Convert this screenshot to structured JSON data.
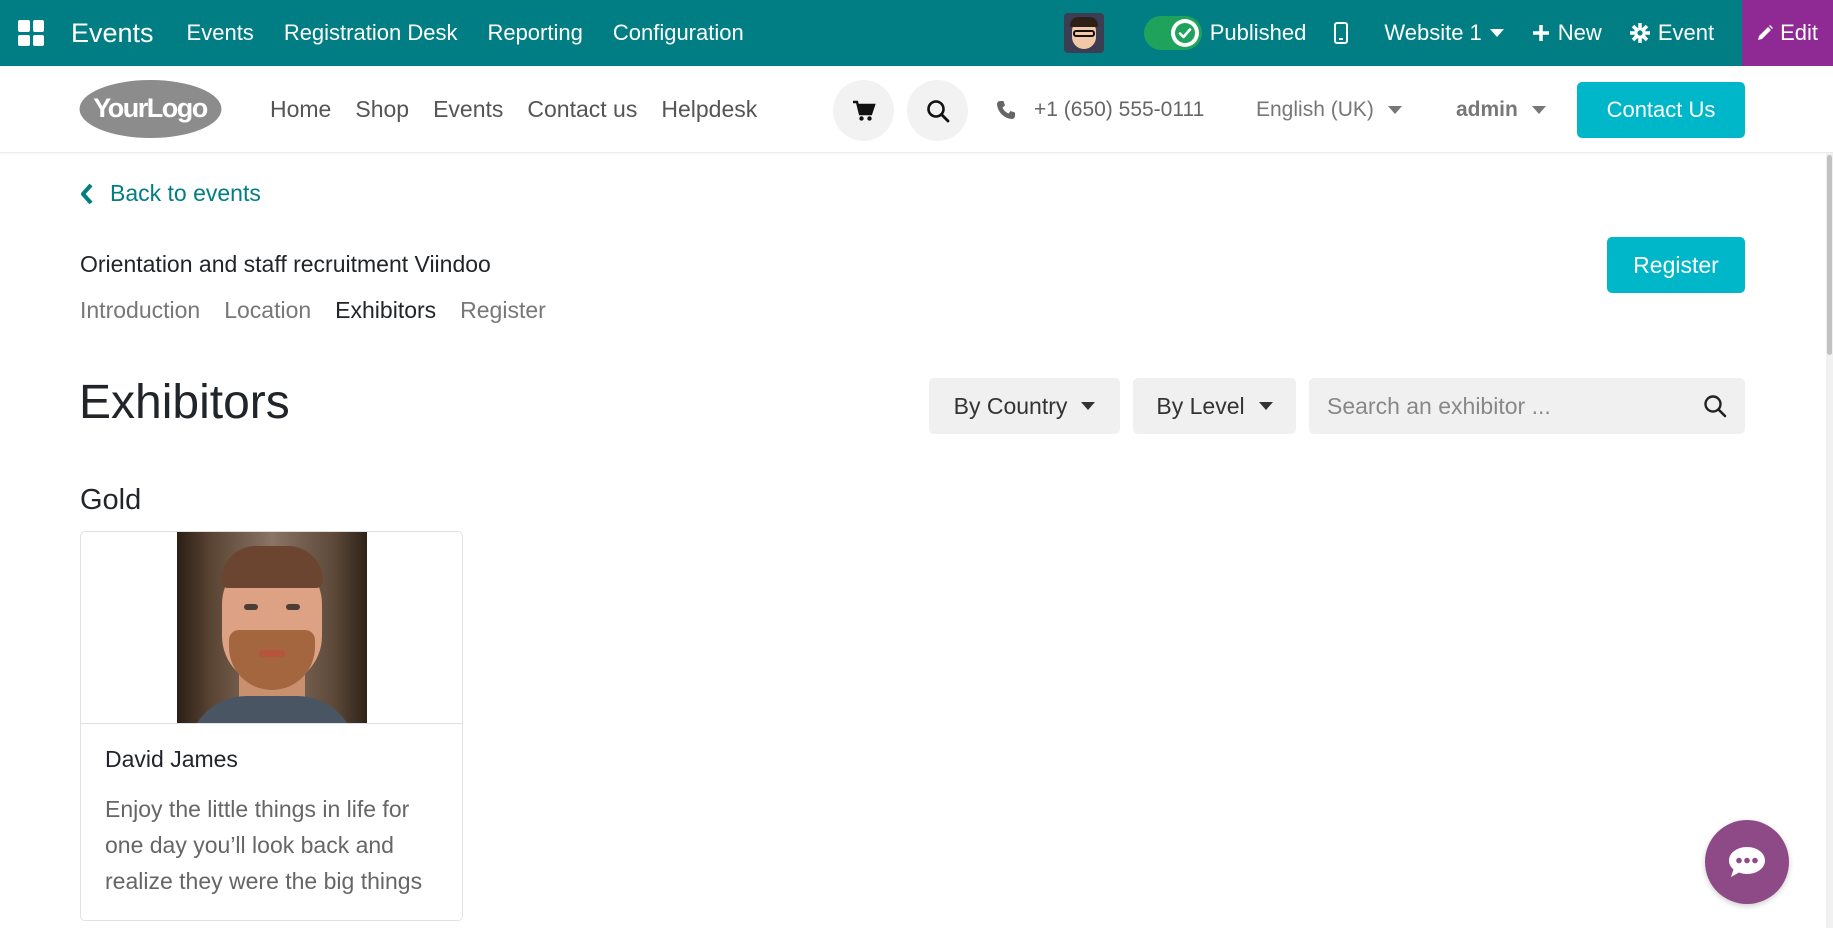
{
  "topbar": {
    "app_name": "Events",
    "menu": [
      "Events",
      "Registration Desk",
      "Reporting",
      "Configuration"
    ],
    "published_label": "Published",
    "website_label": "Website 1",
    "new_label": "New",
    "event_label": "Event",
    "edit_label": "Edit"
  },
  "site_header": {
    "logo_text": "YourLogo",
    "nav": [
      "Home",
      "Shop",
      "Events",
      "Contact us",
      "Helpdesk"
    ],
    "phone": "+1 (650) 555-0111",
    "language": "English (UK)",
    "user": "admin",
    "contact_button": "Contact Us"
  },
  "event": {
    "back_label": "Back to events",
    "title": "Orientation and staff recruitment Viindoo",
    "register_button": "Register",
    "tabs": [
      {
        "label": "Introduction",
        "active": false
      },
      {
        "label": "Location",
        "active": false
      },
      {
        "label": "Exhibitors",
        "active": true
      },
      {
        "label": "Register",
        "active": false
      }
    ]
  },
  "exhibitors": {
    "heading": "Exhibitors",
    "filter_country": "By Country",
    "filter_level": "By Level",
    "search_placeholder": "Search an exhibitor ...",
    "groups": [
      {
        "level": "Gold",
        "items": [
          {
            "name": "David James",
            "description": "Enjoy the little things in life for one day you’ll look back and realize they were the big things"
          }
        ]
      }
    ]
  },
  "colors": {
    "topbar": "#017e84",
    "edit": "#8f2a95",
    "accent": "#00b7c9",
    "chat": "#8e4a86"
  }
}
